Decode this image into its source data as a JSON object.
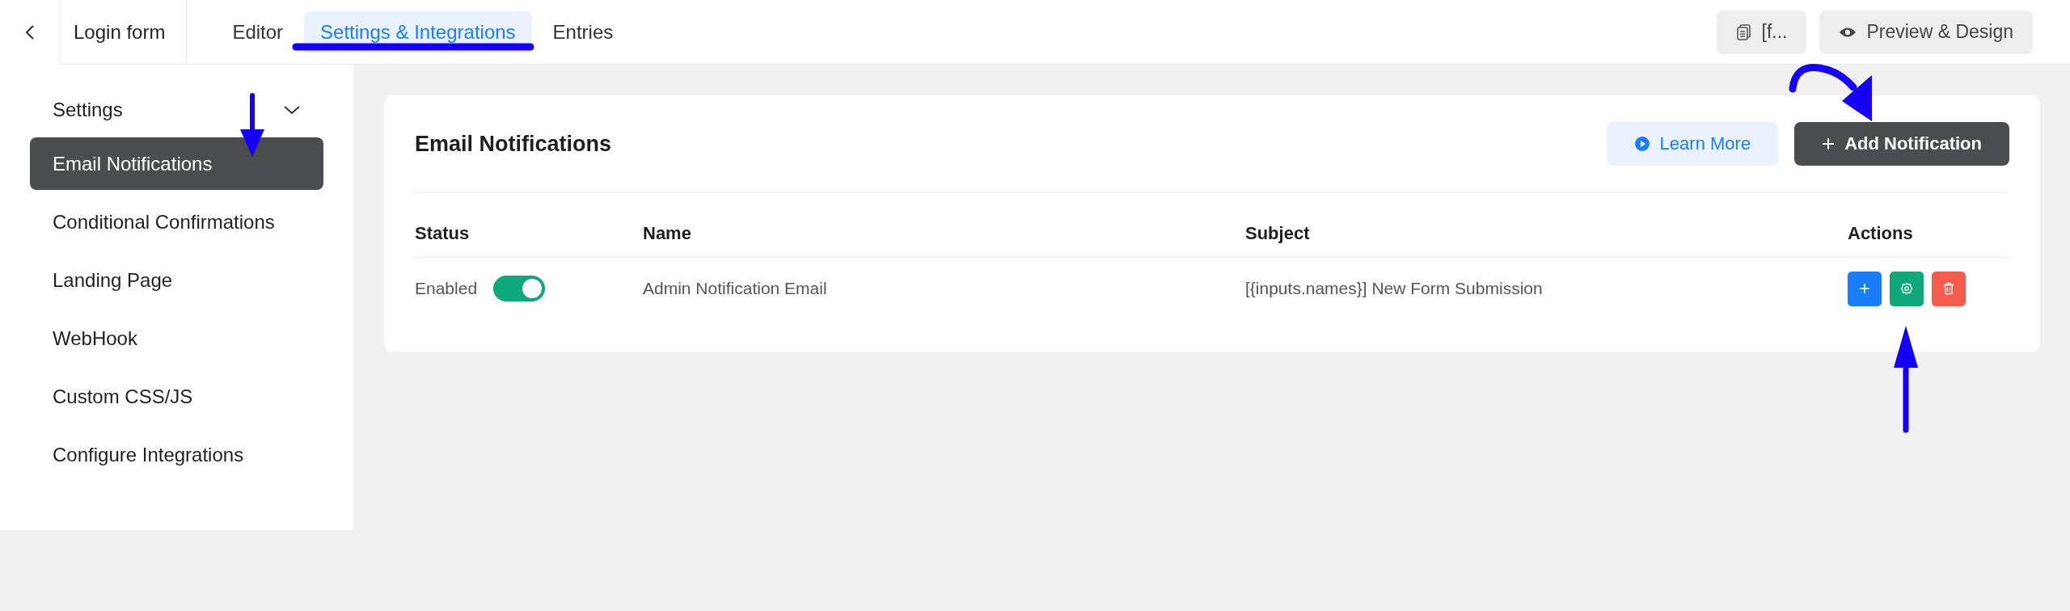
{
  "header": {
    "form_title": "Login form",
    "tabs": [
      {
        "label": "Editor",
        "selected": false
      },
      {
        "label": "Settings & Integrations",
        "selected": true
      },
      {
        "label": "Entries",
        "selected": false
      }
    ],
    "shortcode_button": "[f...",
    "preview_button": "Preview & Design"
  },
  "sidebar": {
    "group": {
      "label": "Settings",
      "expanded": true
    },
    "items": [
      {
        "label": "Email Notifications",
        "selected": true
      },
      {
        "label": "Conditional Confirmations",
        "selected": false
      },
      {
        "label": "Landing Page",
        "selected": false
      },
      {
        "label": "WebHook",
        "selected": false
      },
      {
        "label": "Custom CSS/JS",
        "selected": false
      },
      {
        "label": "Configure Integrations",
        "selected": false
      }
    ]
  },
  "card": {
    "title": "Email Notifications",
    "learn_more": "Learn More",
    "add_button": "Add Notification",
    "table": {
      "columns": [
        "Status",
        "Name",
        "Subject",
        "Actions"
      ],
      "rows": [
        {
          "status": "Enabled",
          "on": true,
          "name": "Admin Notification Email",
          "subject": "[{inputs.names}] New Form Submission",
          "actions": [
            {
              "kind": "add"
            },
            {
              "kind": "settings"
            },
            {
              "kind": "delete"
            }
          ]
        }
      ]
    }
  }
}
